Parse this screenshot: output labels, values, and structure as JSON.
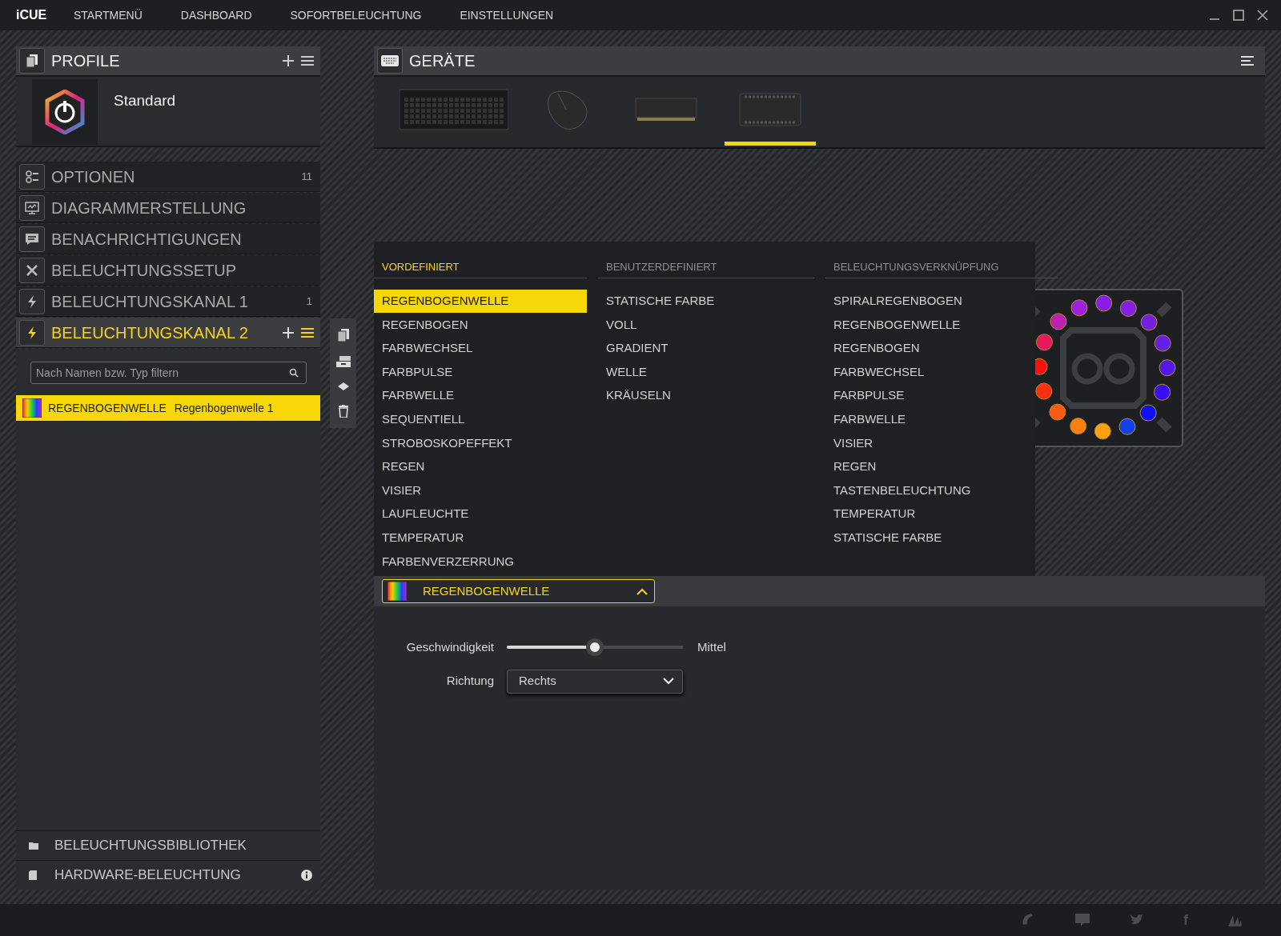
{
  "app_name": "iCUE",
  "menu": [
    {
      "label": "STARTMENÜ"
    },
    {
      "label": "DASHBOARD"
    },
    {
      "label": "SOFORTBELEUCHTUNG"
    },
    {
      "label": "EINSTELLUNGEN"
    }
  ],
  "profiles": {
    "title": "PROFILE",
    "items": [
      {
        "name": "Standard"
      }
    ]
  },
  "sections": [
    {
      "title": "OPTIONEN",
      "count": "11",
      "selected": false
    },
    {
      "title": "DIAGRAMMERSTELLUNG",
      "selected": false
    },
    {
      "title": "BENACHRICHTIGUNGEN",
      "selected": false
    },
    {
      "title": "BELEUCHTUNGSSETUP",
      "selected": false
    },
    {
      "title": "BELEUCHTUNGSKANAL 1",
      "count": "1",
      "selected": false
    },
    {
      "title": "BELEUCHTUNGSKANAL 2",
      "selected": true
    }
  ],
  "filter": {
    "placeholder": "Nach Namen bzw. Typ filtern"
  },
  "layers": [
    {
      "type": "REGENBOGENWELLE",
      "name": "Regenbogenwelle 1",
      "selected": true
    }
  ],
  "library": [
    {
      "label": "BELEUCHTUNGSBIBLIOTHEK",
      "info": false
    },
    {
      "label": "HARDWARE-BELEUCHTUNG",
      "info": true
    }
  ],
  "devices": {
    "title": "GERÄTE",
    "items": [
      {
        "kind": "keyboard",
        "selected": false
      },
      {
        "kind": "mouse",
        "selected": false
      },
      {
        "kind": "memory",
        "selected": false
      },
      {
        "kind": "controller",
        "selected": true
      }
    ]
  },
  "preview": {
    "leds": [
      {
        "color": "#a020e0"
      },
      {
        "color": "#8a1ee8"
      },
      {
        "color": "#8420e0"
      },
      {
        "color": "#7420e0"
      },
      {
        "color": "#6420e4"
      },
      {
        "color": "#5418e8"
      },
      {
        "color": "#3810f0"
      },
      {
        "color": "#1010f8"
      },
      {
        "color": "#1040f0"
      },
      {
        "color": "#ffa010"
      },
      {
        "color": "#ff8010"
      },
      {
        "color": "#ff5a10"
      },
      {
        "color": "#ff3010"
      },
      {
        "color": "#ff1010"
      },
      {
        "color": "#e8185a"
      },
      {
        "color": "#c020b0"
      }
    ]
  },
  "effect_menu": {
    "columns": [
      {
        "title": "VORDEFINIERT",
        "selected": true,
        "items": [
          {
            "label": "REGENBOGENWELLE",
            "selected": true
          },
          {
            "label": "REGENBOGEN",
            "selected": false
          },
          {
            "label": "FARBWECHSEL",
            "selected": false
          },
          {
            "label": "FARBPULSE",
            "selected": false
          },
          {
            "label": "FARBWELLE",
            "selected": false
          },
          {
            "label": "SEQUENTIELL",
            "selected": false
          },
          {
            "label": "STROBOSKOPEFFEKT",
            "selected": false
          },
          {
            "label": "REGEN",
            "selected": false
          },
          {
            "label": "VISIER",
            "selected": false
          },
          {
            "label": "LAUFLEUCHTE",
            "selected": false
          },
          {
            "label": "TEMPERATUR",
            "selected": false
          },
          {
            "label": "FARBENVERZERRUNG",
            "selected": false
          }
        ]
      },
      {
        "title": "BENUTZERDEFINIERT",
        "selected": false,
        "items": [
          {
            "label": "STATISCHE FARBE",
            "selected": false
          },
          {
            "label": "VOLL",
            "selected": false
          },
          {
            "label": "GRADIENT",
            "selected": false
          },
          {
            "label": "WELLE",
            "selected": false
          },
          {
            "label": "KRÄUSELN",
            "selected": false
          }
        ]
      },
      {
        "title": "BELEUCHTUNGSVERKNÜPFUNG",
        "selected": false,
        "items": [
          {
            "label": "SPIRALREGENBOGEN",
            "selected": false
          },
          {
            "label": "REGENBOGENWELLE",
            "selected": false
          },
          {
            "label": "REGENBOGEN",
            "selected": false
          },
          {
            "label": "FARBWECHSEL",
            "selected": false
          },
          {
            "label": "FARBPULSE",
            "selected": false
          },
          {
            "label": "FARBWELLE",
            "selected": false
          },
          {
            "label": "VISIER",
            "selected": false
          },
          {
            "label": "REGEN",
            "selected": false
          },
          {
            "label": "TASTENBELEUCHTUNG",
            "selected": false
          },
          {
            "label": "TEMPERATUR",
            "selected": false
          },
          {
            "label": "STATISCHE FARBE",
            "selected": false
          }
        ]
      }
    ]
  },
  "effect_select": {
    "value": "REGENBOGENWELLE",
    "expanded": true
  },
  "settings": {
    "speed": {
      "label": "Geschwindigkeit",
      "level": 0.5,
      "reading": "Mittel"
    },
    "direction": {
      "label": "Richtung",
      "value": "Rechts"
    }
  },
  "footer": {
    "links": [
      {
        "kind": "support"
      },
      {
        "kind": "chat"
      },
      {
        "kind": "twitter"
      },
      {
        "kind": "letter",
        "label": "f"
      },
      {
        "kind": "sails"
      }
    ]
  }
}
